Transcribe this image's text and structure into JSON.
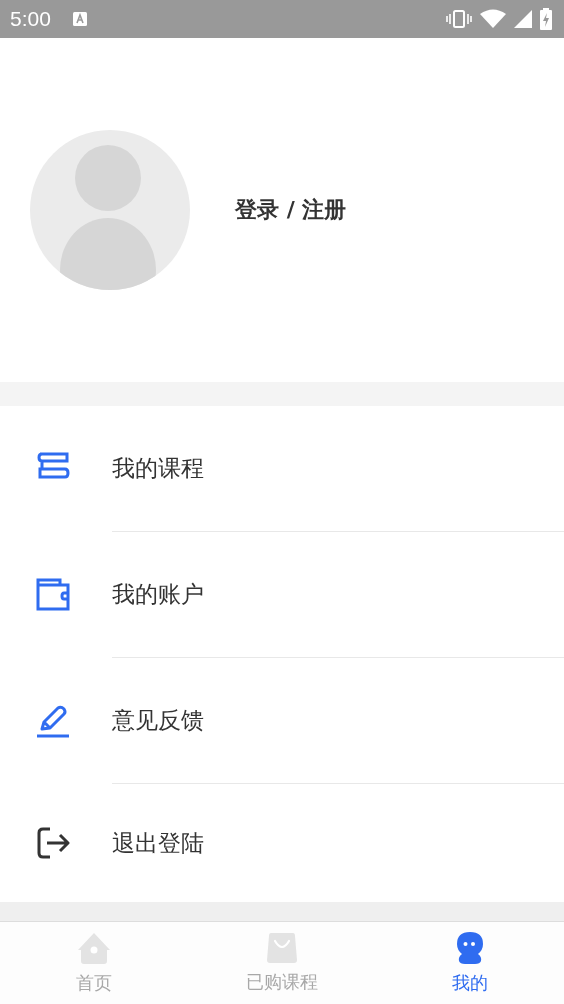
{
  "status_bar": {
    "time": "5:00"
  },
  "profile": {
    "login_label": "登录 / 注册"
  },
  "menu": [
    {
      "kind": "book",
      "label": "我的课程"
    },
    {
      "kind": "wallet",
      "label": "我的账户"
    },
    {
      "kind": "pen",
      "label": "意见反馈"
    },
    {
      "kind": "logout",
      "label": "退出登陆"
    }
  ],
  "tab_bar": [
    {
      "kind": "home",
      "label": "首页",
      "selected": false
    },
    {
      "kind": "bag",
      "label": "已购课程",
      "selected": false
    },
    {
      "kind": "mascot",
      "label": "我的",
      "selected": true
    }
  ]
}
